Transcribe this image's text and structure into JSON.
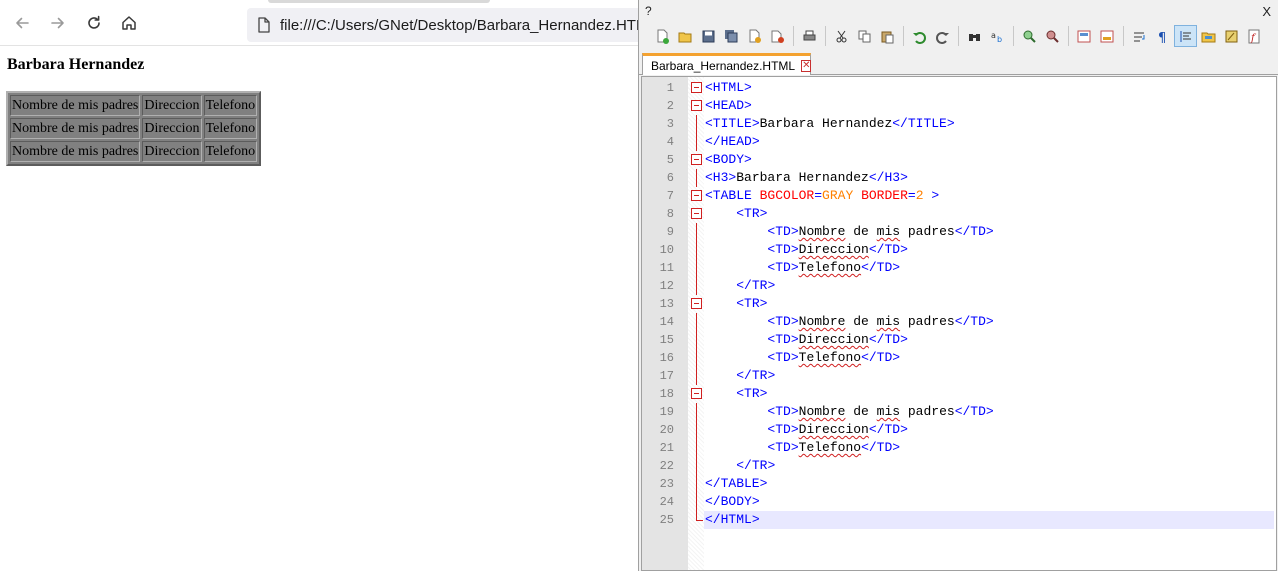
{
  "browser": {
    "url": "file:///C:/Users/GNet/Desktop/Barbara_Hernandez.HTML",
    "page": {
      "heading": "Barbara Hernandez",
      "table": {
        "bgcolor": "#808080",
        "rows": [
          [
            "Nombre de mis padres",
            "Direccion",
            "Telefono"
          ],
          [
            "Nombre de mis padres",
            "Direccion",
            "Telefono"
          ],
          [
            "Nombre de mis padres",
            "Direccion",
            "Telefono"
          ]
        ]
      }
    }
  },
  "editor": {
    "menu_fragment": "?",
    "close_label": "X",
    "tab_label": "Barbara_Hernandez.HTML",
    "tab_close_glyph": "✕",
    "current_line": 25,
    "lines": [
      {
        "n": "1",
        "text": "<HTML>"
      },
      {
        "n": "2",
        "text": "<HEAD>"
      },
      {
        "n": "3",
        "text": "<TITLE>Barbara Hernandez</TITLE>"
      },
      {
        "n": "4",
        "text": "</HEAD>"
      },
      {
        "n": "5",
        "text": "<BODY>"
      },
      {
        "n": "6",
        "text": "<H3>Barbara Hernandez</H3>"
      },
      {
        "n": "7",
        "text": "<TABLE BGCOLOR=GRAY BORDER=2 >"
      },
      {
        "n": "8",
        "text": "    <TR>"
      },
      {
        "n": "9",
        "text": "        <TD>Nombre de mis padres</TD>"
      },
      {
        "n": "10",
        "text": "        <TD>Direccion</TD>"
      },
      {
        "n": "11",
        "text": "        <TD>Telefono</TD>"
      },
      {
        "n": "12",
        "text": "    </TR>"
      },
      {
        "n": "13",
        "text": "    <TR>"
      },
      {
        "n": "14",
        "text": "        <TD>Nombre de mis padres</TD>"
      },
      {
        "n": "15",
        "text": "        <TD>Direccion</TD>"
      },
      {
        "n": "16",
        "text": "        <TD>Telefono</TD>"
      },
      {
        "n": "17",
        "text": "    </TR>"
      },
      {
        "n": "18",
        "text": "    <TR>"
      },
      {
        "n": "19",
        "text": "        <TD>Nombre de mis padres</TD>"
      },
      {
        "n": "20",
        "text": "        <TD>Direccion</TD>"
      },
      {
        "n": "21",
        "text": "        <TD>Telefono</TD>"
      },
      {
        "n": "22",
        "text": "    </TR>"
      },
      {
        "n": "23",
        "text": "</TABLE>"
      },
      {
        "n": "24",
        "text": "</BODY>"
      },
      {
        "n": "25",
        "text": "</HTML>"
      }
    ]
  },
  "colors": {
    "tag": "#0000ff",
    "attribute": "#ff0000",
    "attribute_value": "#ff8000",
    "fold_marker": "#d02020",
    "tab_accent": "#f4a230",
    "current_line_bg": "#e8e8ff"
  },
  "icons": {
    "nav": [
      "arrow-left-icon",
      "arrow-right-icon",
      "reload-icon",
      "home-icon",
      "file-icon"
    ],
    "toolbar": [
      "new-file-icon",
      "open-file-icon",
      "save-icon",
      "save-all-icon",
      "close-icon",
      "close-all-icon",
      "print-icon",
      "cut-icon",
      "copy-icon",
      "paste-icon",
      "undo-icon",
      "redo-icon",
      "find-icon",
      "replace-icon",
      "zoom-in-icon",
      "zoom-out-icon",
      "sync-vertical-icon",
      "sync-horizontal-icon",
      "word-wrap-icon",
      "show-all-chars-icon",
      "indent-guide-icon",
      "folder-workspace-icon",
      "document-map-icon",
      "function-list-icon"
    ]
  }
}
